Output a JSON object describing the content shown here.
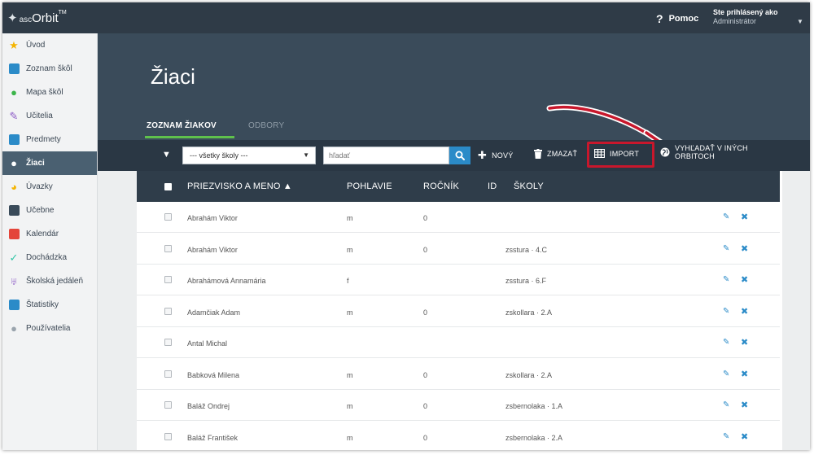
{
  "app": {
    "logo": {
      "prefix": "asc",
      "name": "Orbit",
      "tm": "TM"
    },
    "help_label": "Pomoc",
    "user": {
      "line1": "Ste prihlásený ako",
      "line2": "Administrátor"
    }
  },
  "sidebar": {
    "items": [
      {
        "label": "Úvod",
        "icon": "star-icon",
        "color": "#f4b400"
      },
      {
        "label": "Zoznam škôl",
        "icon": "school-building-icon",
        "color": "#2b8bc8"
      },
      {
        "label": "Mapa škôl",
        "icon": "map-pin-icon",
        "color": "#3cb54a"
      },
      {
        "label": "Učitelia",
        "icon": "teacher-icon",
        "color": "#8a57c5"
      },
      {
        "label": "Predmety",
        "icon": "book-icon",
        "color": "#2b8bc8"
      },
      {
        "label": "Žiaci",
        "icon": "student-icon",
        "color": "#ffffff",
        "active": true
      },
      {
        "label": "Úvazky",
        "icon": "pie-chart-icon",
        "color": "#f4b400"
      },
      {
        "label": "Učebne",
        "icon": "classroom-door-icon",
        "color": "#3a4b5a"
      },
      {
        "label": "Kalendár",
        "icon": "calendar-icon",
        "color": "#e4453a"
      },
      {
        "label": "Dochádzka",
        "icon": "attendance-check-icon",
        "color": "#2ec4a5"
      },
      {
        "label": "Školská jedáleň",
        "icon": "dining-glass-icon",
        "color": "#8a57c5"
      },
      {
        "label": "Štatistiky",
        "icon": "bar-chart-icon",
        "color": "#2b8bc8"
      },
      {
        "label": "Používatelia",
        "icon": "user-icon",
        "color": "#9aa4ad"
      }
    ]
  },
  "header": {
    "title": "Žiaci",
    "tabs": [
      {
        "label": "ZOZNAM ŽIAKOV",
        "active": true
      },
      {
        "label": "ODBORY",
        "active": false
      }
    ]
  },
  "toolbar": {
    "school_filter": "--- všetky školy ---",
    "search_placeholder": "hľadať",
    "new_label": "NOVÝ",
    "delete_label": "ZMAZAŤ",
    "import_label": "IMPORT",
    "orbit_label_line1": "VYHĽADAŤ V INÝCH",
    "orbit_label_line2": "ORBITOCH",
    "highlight_color": "#c8172c"
  },
  "table": {
    "columns": [
      "PRIEZVISKO A MENO ▲",
      "POHLAVIE",
      "ROČNÍK",
      "ID",
      "ŠKOLY"
    ],
    "rows": [
      {
        "name": "Abrahám Viktor",
        "sex": "m",
        "year": "0",
        "school": ""
      },
      {
        "name": "Abrahám Viktor",
        "sex": "m",
        "year": "0",
        "school": "zsstura · 4.C"
      },
      {
        "name": "Abrahámová Annamária",
        "sex": "f",
        "year": "",
        "school": "zsstura · 6.F"
      },
      {
        "name": "Adamčiak Adam",
        "sex": "m",
        "year": "0",
        "school": "zskollara · 2.A"
      },
      {
        "name": "Antal Michal",
        "sex": "",
        "year": "",
        "school": ""
      },
      {
        "name": "Babková Milena",
        "sex": "m",
        "year": "0",
        "school": "zskollara · 2.A"
      },
      {
        "name": "Baláž Ondrej",
        "sex": "m",
        "year": "0",
        "school": "zsbernolaka · 1.A"
      },
      {
        "name": "Baláž František",
        "sex": "m",
        "year": "0",
        "school": "zsbernolaka · 2.A"
      }
    ]
  }
}
